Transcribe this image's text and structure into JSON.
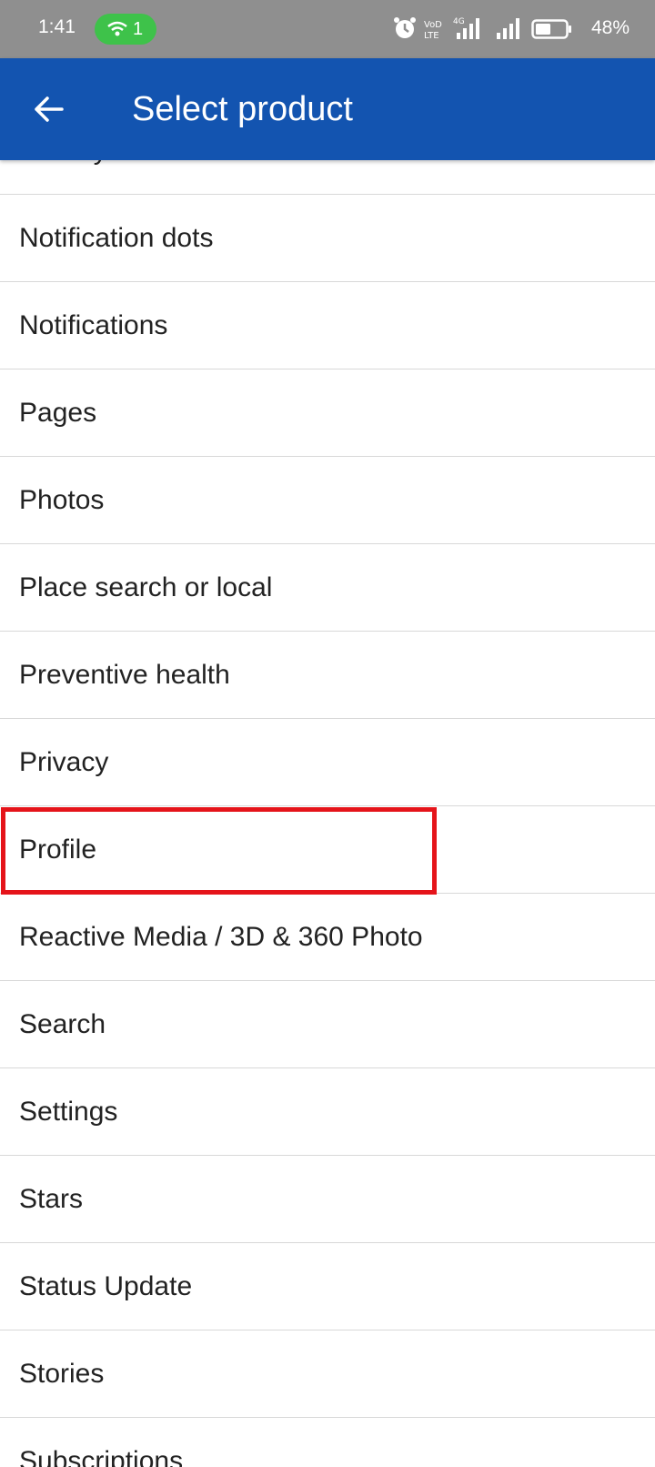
{
  "status_bar": {
    "time": "1:41",
    "hotspot_count": "1",
    "battery": "48%",
    "icons": [
      "hotspot-icon",
      "alarm-icon",
      "volte-icon",
      "signal-4g-icon",
      "signal-icon",
      "battery-icon"
    ]
  },
  "app_bar": {
    "title": "Select product",
    "back_icon": "arrow-left-icon",
    "color": "#1354b0"
  },
  "products": [
    "Nearby friends",
    "Notification dots",
    "Notifications",
    "Pages",
    "Photos",
    "Place search or local",
    "Preventive health",
    "Privacy",
    "Profile",
    "Reactive Media / 3D & 360 Photo",
    "Search",
    "Settings",
    "Stars",
    "Status Update",
    "Stories",
    "Subscriptions"
  ],
  "highlighted_item": "Profile",
  "highlight_color": "#e5141a"
}
